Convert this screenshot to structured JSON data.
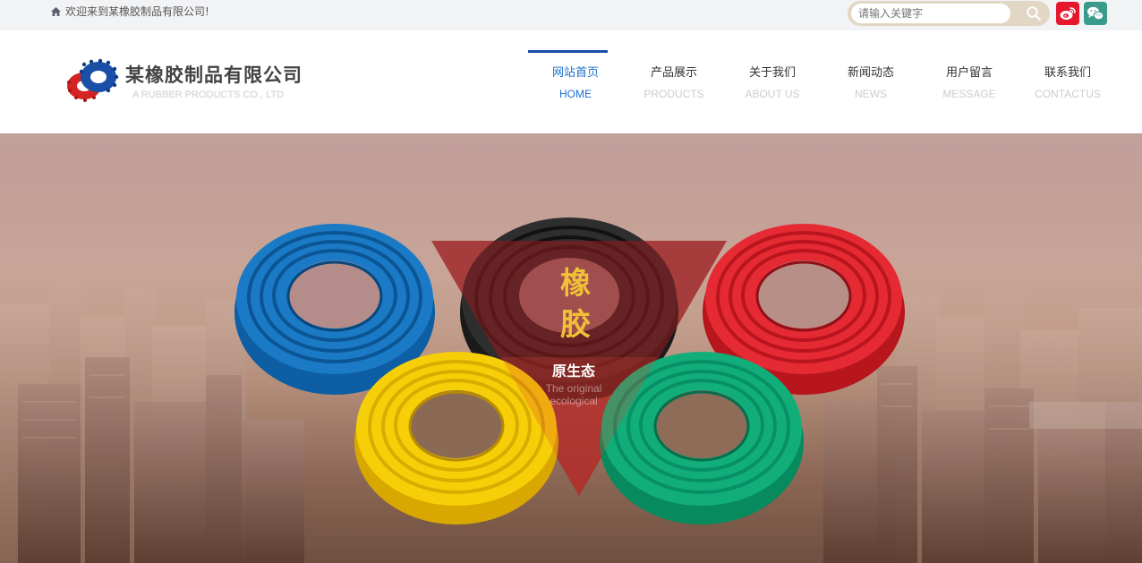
{
  "topbar": {
    "welcome_text": "欢迎来到某橡胶制品有限公司!",
    "search_placeholder": "请输入关键字"
  },
  "logo": {
    "cn": "某橡胶制品有限公司",
    "en": "A RUBBER PRODUCTS CO., LTD"
  },
  "nav": [
    {
      "cn": "网站首页",
      "en": "HOME"
    },
    {
      "cn": "产品展示",
      "en": "PRODUCTS"
    },
    {
      "cn": "关于我们",
      "en": "ABOUT US"
    },
    {
      "cn": "新闻动态",
      "en": "NEWS"
    },
    {
      "cn": "用户留言",
      "en": "MESSAGE"
    },
    {
      "cn": "联系我们",
      "en": "CONTACTUS"
    }
  ],
  "hero": {
    "char1": "橡",
    "char2": "胶",
    "subtitle_cn": "原生态",
    "subtitle_en": "The original ecological"
  },
  "colors": {
    "accent": "#1b6fd1",
    "nav_active_bar": "#1a4ea6",
    "weibo": "#e6162d",
    "wechat": "#3a9b8a",
    "hero_text": "#f0c038"
  },
  "icons": [
    "home-icon",
    "search-icon",
    "weibo-icon",
    "wechat-icon"
  ]
}
